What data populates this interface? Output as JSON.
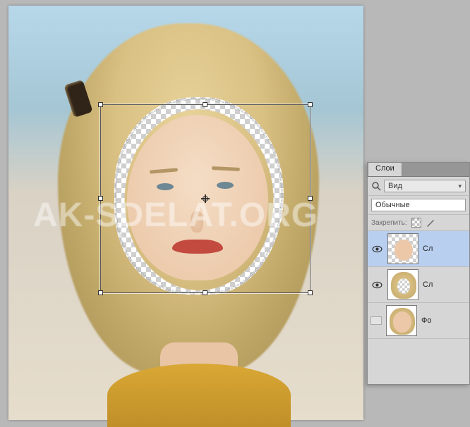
{
  "watermark": "AK-SDELAT.ORG",
  "panel": {
    "tab_label": "Слои",
    "filter_label": "Вид",
    "blend_mode": "Обычные",
    "lock_label": "Закрепить:"
  },
  "layers": [
    {
      "name": "Сл",
      "visible": true,
      "selected": true,
      "thumb": "face-cutout"
    },
    {
      "name": "Сл",
      "visible": true,
      "selected": false,
      "thumb": "face-hole"
    },
    {
      "name": "Фо",
      "visible": false,
      "selected": false,
      "thumb": "full-photo"
    }
  ]
}
